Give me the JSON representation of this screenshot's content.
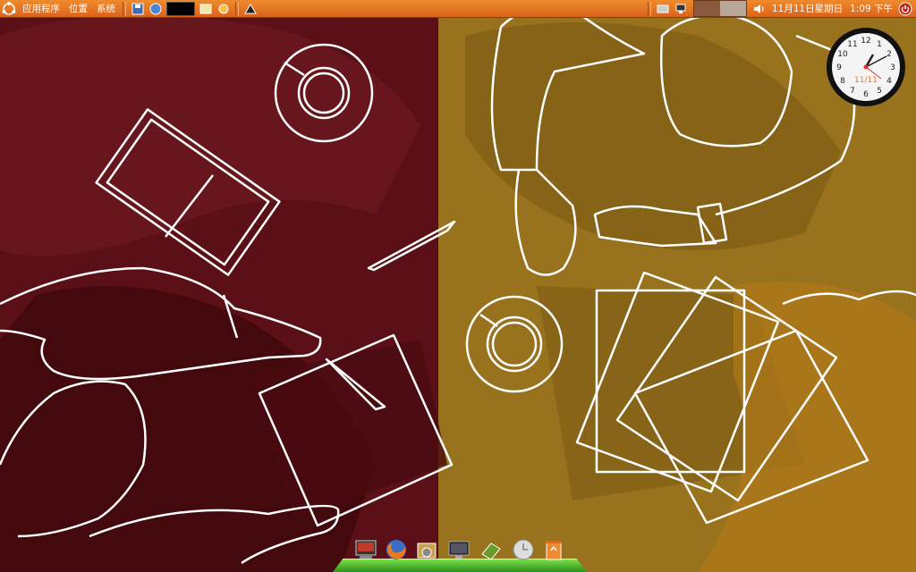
{
  "panel": {
    "menus": [
      {
        "label": "应用程序"
      },
      {
        "label": "位置"
      },
      {
        "label": "系统"
      }
    ],
    "launchers": [
      "save-icon",
      "web-browser-icon",
      "window-list-icon",
      "notes-icon",
      "updates-icon",
      "trash-icon"
    ],
    "tray": {
      "date": "11月11日星期日",
      "time": "1:09 下午"
    }
  },
  "clock_widget": {
    "date_label": "11/11",
    "numbers": [
      "12",
      "1",
      "2",
      "3",
      "4",
      "5",
      "6",
      "7",
      "8",
      "9",
      "10",
      "11"
    ]
  },
  "dock": {
    "items": [
      "terminal-icon",
      "firefox-icon",
      "package-manager-icon",
      "desktop-icon",
      "books-icon",
      "clock-icon",
      "recycle-bin-icon"
    ]
  },
  "colors": {
    "panel": "#e8761f",
    "wallpaper_left": "#5a1016",
    "wallpaper_right": "#9a7420",
    "dock_shelf": "#55c02e"
  }
}
